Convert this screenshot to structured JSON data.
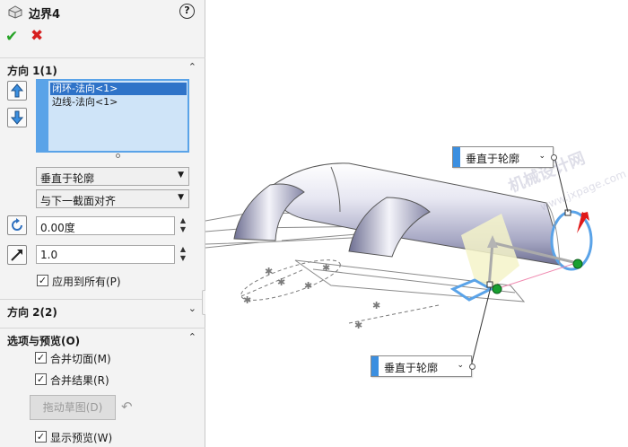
{
  "feature": {
    "icon": "boundary-feature-icon",
    "title": "边界4",
    "help_icon": "help-icon"
  },
  "actions": {
    "ok_icon": "checkmark-icon",
    "cancel_icon": "cancel-x-icon"
  },
  "direction1": {
    "header": "方向 1(1)",
    "items": [
      "闭环-法向<1>",
      "边线-法向<1>"
    ],
    "selected_index": 0,
    "tangency_type": "垂直于轮廓",
    "alignment": "与下一截面对齐",
    "angle_value": "0.00度",
    "tangent_length": "1.0",
    "apply_all_label": "应用到所有(P)",
    "apply_all_checked": true
  },
  "direction2": {
    "header": "方向 2(2)"
  },
  "options": {
    "header": "选项与预览(O)",
    "merge_tangent_faces_label": "合并切面(M)",
    "merge_tangent_faces_checked": true,
    "merge_result_label": "合并结果(R)",
    "merge_result_checked": true,
    "drag_sketch_label": "拖动草图(D)",
    "show_preview_label": "显示预览(W)",
    "show_preview_checked": true
  },
  "viewport": {
    "callout_top": "垂直于轮廓",
    "callout_bottom": "垂直于轮廓",
    "watermark_1": "机械设计网",
    "watermark_2": "www.jxpage.com",
    "accent_color": "#3b8fe0",
    "handle_color": "#18a030",
    "arrow_color": "#e01818"
  }
}
